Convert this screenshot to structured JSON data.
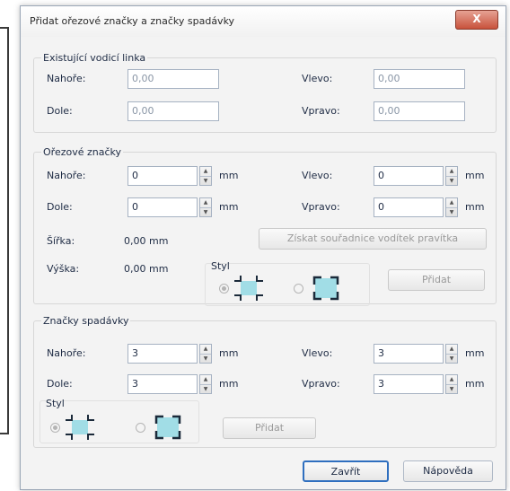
{
  "window": {
    "title": "Přidat ořezové značky a značky spadávky",
    "close_glyph": "X"
  },
  "guides": {
    "title": "Existující vodicí linka",
    "top_label": "Nahoře:",
    "top_value": "0,00",
    "bottom_label": "Dole:",
    "bottom_value": "0,00",
    "left_label": "Vlevo:",
    "left_value": "0,00",
    "right_label": "Vpravo:",
    "right_value": "0,00"
  },
  "crop": {
    "title": "Ořezové značky",
    "top_label": "Nahoře:",
    "top_value": "0",
    "bottom_label": "Dole:",
    "bottom_value": "0",
    "left_label": "Vlevo:",
    "left_value": "0",
    "right_label": "Vpravo:",
    "right_value": "0",
    "unit": "mm",
    "width_label": "Šířka:",
    "width_value": "0,00 mm",
    "height_label": "Výška:",
    "height_value": "0,00 mm",
    "get_coords_button": "Získat souřadnice vodítek pravítka",
    "style_label": "Styl",
    "add_button": "Přidat"
  },
  "bleed": {
    "title": "Značky spadávky",
    "top_label": "Nahoře:",
    "top_value": "3",
    "bottom_label": "Dole:",
    "bottom_value": "3",
    "left_label": "Vlevo:",
    "left_value": "3",
    "right_label": "Vpravo:",
    "right_value": "3",
    "unit": "mm",
    "style_label": "Styl",
    "add_button": "Přidat"
  },
  "footer": {
    "close_button": "Zavřít",
    "help_button": "Nápověda"
  },
  "colors": {
    "accent_cyan": "#3ec4d6",
    "mark_dark": "#1b2a3a",
    "close_red": "#c8523c"
  }
}
